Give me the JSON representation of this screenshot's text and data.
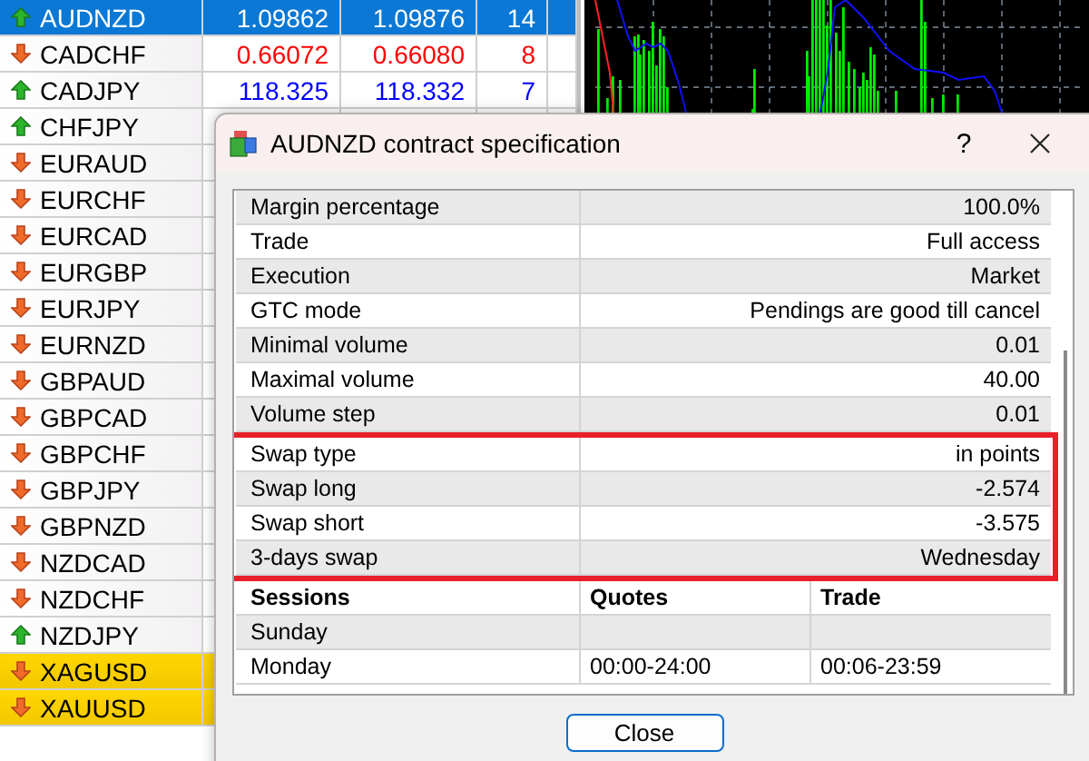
{
  "market_watch": {
    "rows": [
      {
        "symbol": "AUDNZD",
        "kind": "up",
        "bid": "1.09862",
        "ask": "1.09876",
        "spread": "14",
        "selected": true,
        "highlighted": false,
        "color": "#ffffff"
      },
      {
        "symbol": "CADCHF",
        "kind": "down",
        "bid": "0.66072",
        "ask": "0.66080",
        "spread": "8",
        "selected": false,
        "highlighted": false,
        "color": "#ff0000"
      },
      {
        "symbol": "CADJPY",
        "kind": "up",
        "bid": "118.325",
        "ask": "118.332",
        "spread": "7",
        "selected": false,
        "highlighted": false,
        "color": "#0000ff"
      },
      {
        "symbol": "CHFJPY",
        "kind": "up",
        "selected": false,
        "highlighted": false
      },
      {
        "symbol": "EURAUD",
        "kind": "down",
        "selected": false,
        "highlighted": false
      },
      {
        "symbol": "EURCHF",
        "kind": "down",
        "selected": false,
        "highlighted": false
      },
      {
        "symbol": "EURCAD",
        "kind": "down",
        "selected": false,
        "highlighted": false
      },
      {
        "symbol": "EURGBP",
        "kind": "down",
        "selected": false,
        "highlighted": false
      },
      {
        "symbol": "EURJPY",
        "kind": "down",
        "selected": false,
        "highlighted": false
      },
      {
        "symbol": "EURNZD",
        "kind": "down",
        "selected": false,
        "highlighted": false
      },
      {
        "symbol": "GBPAUD",
        "kind": "down",
        "selected": false,
        "highlighted": false
      },
      {
        "symbol": "GBPCAD",
        "kind": "down",
        "selected": false,
        "highlighted": false
      },
      {
        "symbol": "GBPCHF",
        "kind": "down",
        "selected": false,
        "highlighted": false
      },
      {
        "symbol": "GBPJPY",
        "kind": "down",
        "selected": false,
        "highlighted": false
      },
      {
        "symbol": "GBPNZD",
        "kind": "down",
        "selected": false,
        "highlighted": false
      },
      {
        "symbol": "NZDCAD",
        "kind": "down",
        "selected": false,
        "highlighted": false
      },
      {
        "symbol": "NZDCHF",
        "kind": "down",
        "selected": false,
        "highlighted": false
      },
      {
        "symbol": "NZDJPY",
        "kind": "up",
        "selected": false,
        "highlighted": false
      },
      {
        "symbol": "XAGUSD",
        "kind": "down",
        "selected": false,
        "highlighted": true
      },
      {
        "symbol": "XAUUSD",
        "kind": "down",
        "selected": false,
        "highlighted": true
      }
    ]
  },
  "dialog": {
    "title": "AUDNZD contract specification",
    "help": "?",
    "spec_rows": [
      {
        "label": "Margin percentage",
        "value": "100.0%",
        "marked": false
      },
      {
        "label": "Trade",
        "value": "Full access",
        "marked": false
      },
      {
        "label": "Execution",
        "value": "Market",
        "marked": false
      },
      {
        "label": "GTC mode",
        "value": "Pendings are good till cancel",
        "marked": false
      },
      {
        "label": "Minimal volume",
        "value": "0.01",
        "marked": false
      },
      {
        "label": "Maximal volume",
        "value": "40.00",
        "marked": false
      },
      {
        "label": "Volume step",
        "value": "0.01",
        "marked": false
      },
      {
        "label": "Swap type",
        "value": "in points",
        "marked": true
      },
      {
        "label": "Swap long",
        "value": "-2.574",
        "marked": true
      },
      {
        "label": "Swap short",
        "value": "-3.575",
        "marked": true
      },
      {
        "label": "3-days swap",
        "value": "Wednesday",
        "marked": true
      }
    ],
    "sessions": {
      "columns": [
        "Sessions",
        "Quotes",
        "Trade"
      ],
      "rows": [
        [
          "Sunday",
          "",
          ""
        ],
        [
          "Monday",
          "00:00-24:00",
          "00:06-23:59"
        ]
      ]
    },
    "button": "Close"
  }
}
